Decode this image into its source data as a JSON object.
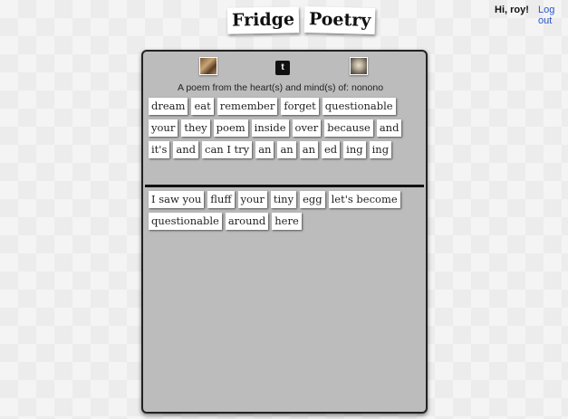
{
  "header": {
    "title_words": [
      "Fridge",
      "Poetry"
    ],
    "greeting": "Hi, roy!",
    "logout_label": "Log out"
  },
  "board": {
    "icons": [
      "photo-icon",
      "twitter-icon",
      "photo-icon"
    ],
    "twitter_glyph": "🐦",
    "attribution": "A poem from the heart(s) and mind(s) of: nonono",
    "word_bank": [
      "dream",
      "eat",
      "remember",
      "forget",
      "questionable",
      "your",
      "they",
      "poem",
      "inside",
      "over",
      "because",
      "and",
      "it's",
      "and",
      "can I try",
      "an",
      "an",
      "an",
      "ed",
      "ing",
      "ing"
    ],
    "poem_words": [
      "I saw you",
      "fluff",
      "your",
      "tiny",
      "egg",
      "let's become",
      "questionable",
      "around",
      "here"
    ]
  }
}
